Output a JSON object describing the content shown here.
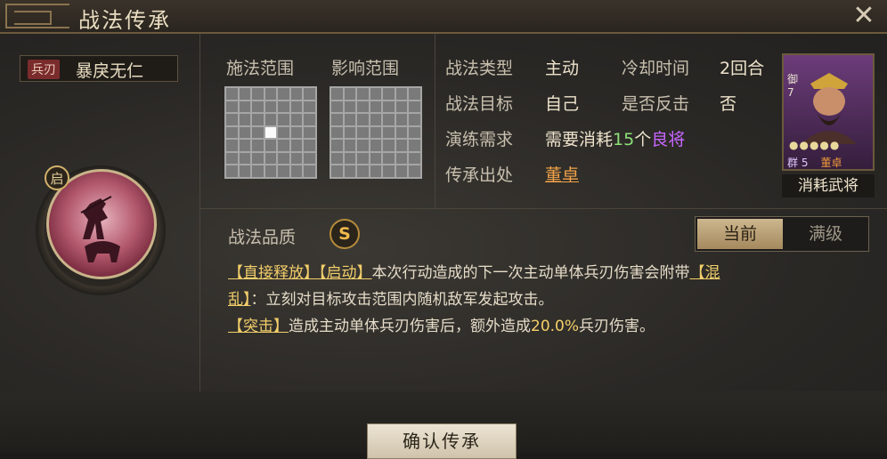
{
  "window": {
    "title": "战法传承"
  },
  "skill": {
    "tag": "兵刃",
    "name": "暴戾无仁",
    "badge": "启"
  },
  "ranges": {
    "cast_label": "施法范围",
    "effect_label": "影响范围"
  },
  "info": {
    "type_label": "战法类型",
    "type_value": "主动",
    "cooldown_label": "冷却时间",
    "cooldown_value": "2回合",
    "target_label": "战法目标",
    "target_value": "自己",
    "counter_label": "是否反击",
    "counter_value": "否",
    "train_label": "演练需求",
    "train_prefix": "需要消耗",
    "train_count": "15",
    "train_mid": "个",
    "train_tier": "良将",
    "source_label": "传承出处",
    "source_value": "董卓"
  },
  "card": {
    "side": "御",
    "side_num": "7",
    "faction": "群",
    "level": "5",
    "general": "董卓",
    "label": "消耗武将",
    "stars": "●●●●●"
  },
  "quality": {
    "label": "战法品质",
    "grade": "S"
  },
  "toggle": {
    "current": "当前",
    "max": "满级"
  },
  "description": {
    "line1_kw1": "【直接释放】",
    "line1_kw2": "【启动】",
    "line1_text": "本次行动造成的下一次主动单体兵刃伤害会附带",
    "line1_kw3": "【混",
    "line2_kw3": "乱】",
    "line2_text": "：立刻对目标攻击范围内随机敌军发起攻击。",
    "line3_kw": "【突击】",
    "line3_text": "造成主动单体兵刃伤害后，额外造成",
    "line3_pct": "20.0%",
    "line3_end": "兵刃伤害。"
  },
  "buttons": {
    "confirm": "确认传承",
    "close": "✕"
  }
}
